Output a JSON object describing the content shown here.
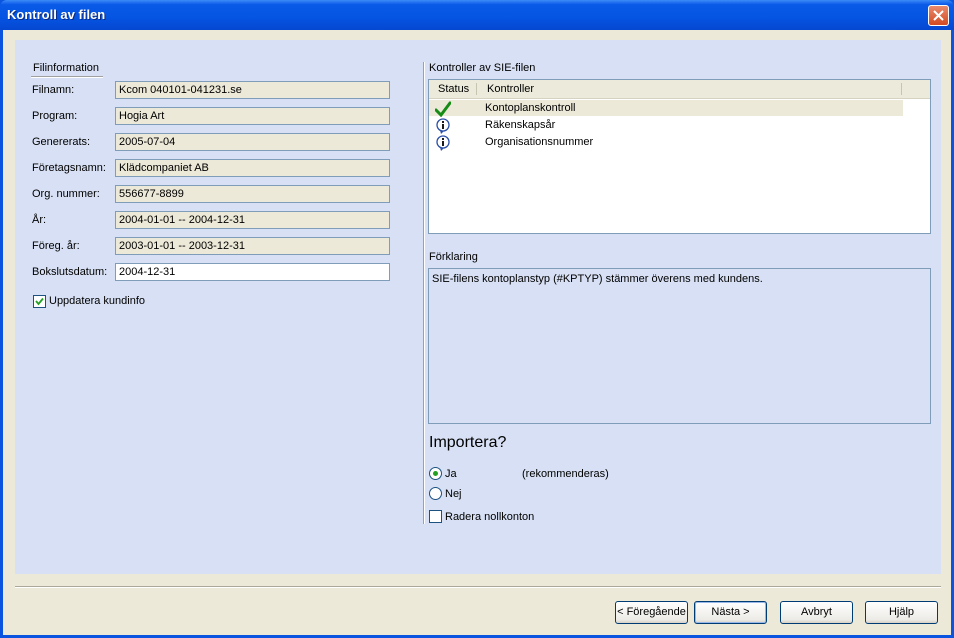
{
  "window": {
    "title": "Kontroll av filen"
  },
  "fileinfo": {
    "group_title": "Filinformation",
    "rows": [
      {
        "label": "Filnamn:",
        "value": "Kcom 040101-041231.se"
      },
      {
        "label": "Program:",
        "value": "Hogia Art"
      },
      {
        "label": "Genererats:",
        "value": "2005-07-04"
      },
      {
        "label": "Företagsnamn:",
        "value": "Klädcompaniet AB"
      },
      {
        "label": "Org. nummer:",
        "value": "556677-8899"
      },
      {
        "label": "År:",
        "value": "2004-01-01 -- 2004-12-31"
      },
      {
        "label": "Föreg. år:",
        "value": "2003-01-01 -- 2003-12-31"
      },
      {
        "label": "Bokslutsdatum:",
        "value": "2004-12-31"
      }
    ],
    "update_checkbox": {
      "label": "Uppdatera kundinfo",
      "checked": true
    }
  },
  "checks": {
    "title": "Kontroller av SIE-filen",
    "columns": [
      "Status",
      "Kontroller"
    ],
    "items": [
      {
        "status_icon": "check-icon",
        "label": "Kontoplanskontroll"
      },
      {
        "status_icon": "info-icon",
        "label": "Räkenskapsår"
      },
      {
        "status_icon": "info-icon",
        "label": "Organisationsnummer"
      }
    ]
  },
  "explanation": {
    "title": "Förklaring",
    "text": "SIE-filens kontoplanstyp (#KPTYP) stämmer överens med kundens."
  },
  "import": {
    "heading": "Importera?",
    "options": [
      {
        "label": "Ja",
        "note": "(rekommenderas)",
        "selected": true
      },
      {
        "label": "Nej",
        "note": "",
        "selected": false
      }
    ],
    "delete_zero_accounts": {
      "label": "Radera nollkonton",
      "checked": false
    }
  },
  "buttons": {
    "previous": "< Föregående",
    "next": "Nästa >",
    "cancel": "Avbryt",
    "help": "Hjälp"
  },
  "colors": {
    "titlebar": "#0554e2",
    "panel": "#d7e0f4",
    "dialog": "#ece9d8",
    "check": "#21a121"
  }
}
